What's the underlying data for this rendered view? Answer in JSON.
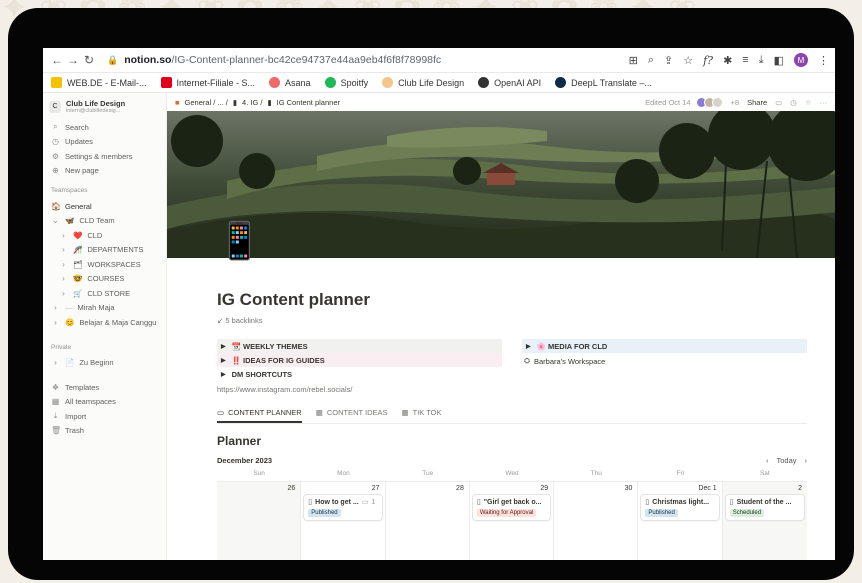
{
  "browser": {
    "host": "notion.so",
    "path": "/IG-Content-planner-bc42ce94737e44aa9eb4f6f8f78998fc",
    "profile_initial": "M"
  },
  "bookmarks": [
    {
      "label": "WEB.DE - E-Mail-...",
      "color": "#f6c100"
    },
    {
      "label": "Internet-Filiale - S...",
      "color": "#e2001a"
    },
    {
      "label": "Asana",
      "color": "#f06a6a"
    },
    {
      "label": "Spoitfy",
      "color": "#1db954"
    },
    {
      "label": "Club Life Design",
      "color": "#f3c68a"
    },
    {
      "label": "OpenAI API",
      "color": "#333333"
    },
    {
      "label": "DeepL Translate –...",
      "color": "#0f2b46"
    }
  ],
  "sidebar": {
    "workspace_name": "Club Life Design",
    "workspace_email": "intern@clublifedesig...",
    "workspace_initial": "C",
    "nav": [
      {
        "label": "Search",
        "icon": "search-icon"
      },
      {
        "label": "Updates",
        "icon": "clock-icon"
      },
      {
        "label": "Settings & members",
        "icon": "gear-icon"
      },
      {
        "label": "New page",
        "icon": "plus-icon"
      }
    ],
    "teamspaces_label": "Teamspaces",
    "teamspaces": [
      {
        "label": "General",
        "icon": "🏠",
        "level": 0
      },
      {
        "label": "CLD Team",
        "icon": "🦋",
        "level": 0
      },
      {
        "label": "CLD",
        "icon": "❤️",
        "level": 1
      },
      {
        "label": "DEPARTMENTS",
        "icon": "🎢",
        "level": 1
      },
      {
        "label": "WORKSPACES",
        "icon": "🗂",
        "level": 1
      },
      {
        "label": "COURSES",
        "icon": "🤓",
        "level": 1
      },
      {
        "label": "CLD STORE",
        "icon": "🛒",
        "level": 1
      },
      {
        "label": "Mirah Maja",
        "icon": "—",
        "level": 0
      },
      {
        "label": "Belajar & Maja Canggu",
        "icon": "😊",
        "level": 0
      }
    ],
    "private_label": "Private",
    "private": [
      {
        "label": "Zu Beginn",
        "icon": "📄"
      }
    ],
    "bottom": [
      {
        "label": "Templates",
        "icon": "templates-icon"
      },
      {
        "label": "All teamspaces",
        "icon": "grid-icon"
      },
      {
        "label": "Import",
        "icon": "import-icon"
      },
      {
        "label": "Trash",
        "icon": "trash-icon"
      }
    ]
  },
  "topbar": {
    "crumbs": [
      "General / ... /",
      "4. IG /",
      "IG Content planner"
    ],
    "edited": "Edited Oct 14",
    "extra_count": "+8",
    "share": "Share"
  },
  "page": {
    "icon": "📱",
    "title": "IG Content planner",
    "backlinks": "5 backlinks",
    "toggles_left": [
      {
        "label": "📆 WEEKLY THEMES",
        "style": "gray"
      },
      {
        "label": "‼️ IDEAS FOR IG GUIDES",
        "style": "pink"
      },
      {
        "label": "DM SHORTCUTS",
        "style": "none"
      }
    ],
    "toggle_right": "🌸 MEDIA FOR CLD",
    "workspace_link": "Barbara's Workspace",
    "url_text": "https://www.instagram.com/rebel.socials/",
    "tabs": [
      "CONTENT PLANNER",
      "CONTENT IDEAS",
      "TIK TOK"
    ],
    "section_title": "Planner",
    "month": "December 2023",
    "today": "Today",
    "weekdays": [
      "Sun",
      "Mon",
      "Tue",
      "Wed",
      "Thu",
      "Fri",
      "Sat"
    ],
    "dates": [
      "26",
      "27",
      "28",
      "29",
      "30",
      "Dec 1",
      "2"
    ],
    "cards": {
      "mon": {
        "title": "How to get ...",
        "comments": "1",
        "status": "Published"
      },
      "wed": {
        "title": "\"Girl get back o...",
        "status": "Waiting for Approval"
      },
      "fri": {
        "title": "Christmas light...",
        "status": "Published"
      },
      "sat": {
        "title": "Student of the ...",
        "status": "Scheduled"
      }
    }
  }
}
